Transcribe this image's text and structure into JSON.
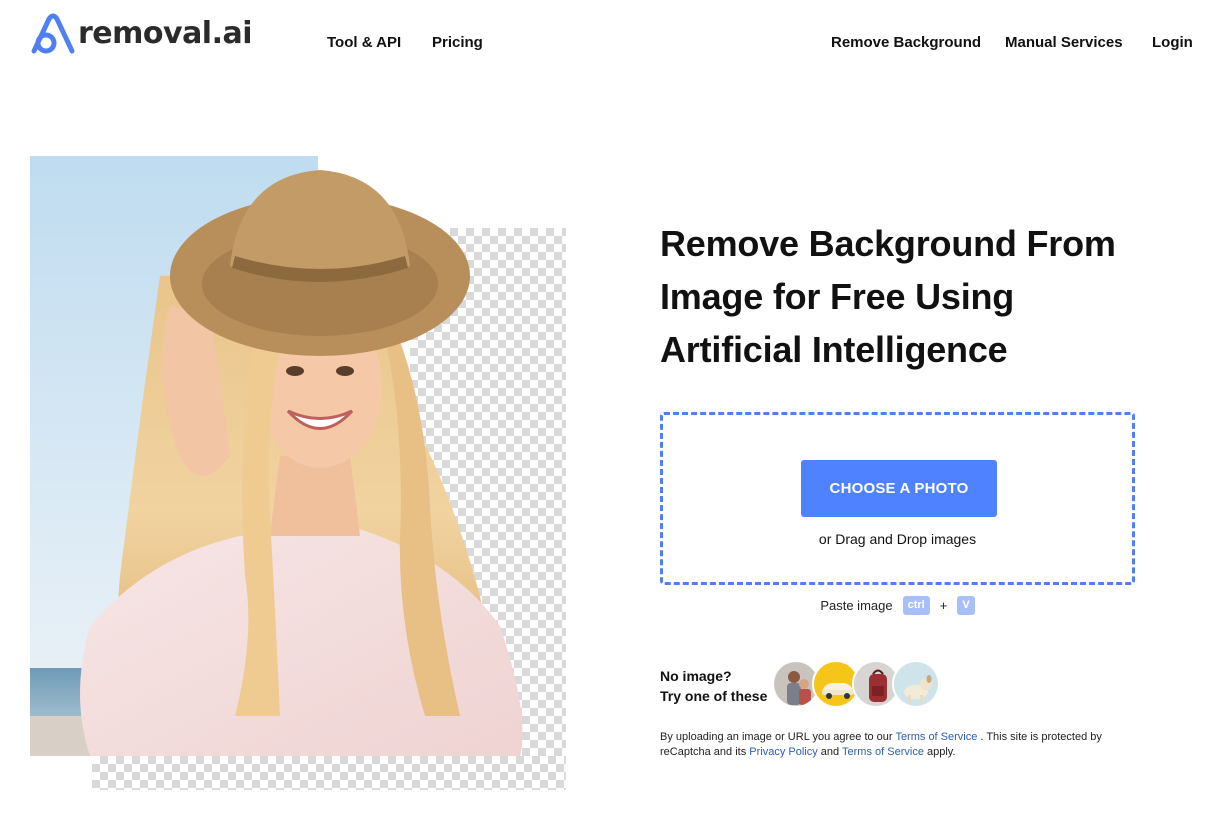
{
  "brand": {
    "name": "removal",
    "tld": ".ai",
    "accent": "#4f7ff2"
  },
  "nav": {
    "left": [
      {
        "label": "Tool & API"
      },
      {
        "label": "Pricing"
      }
    ],
    "right": [
      {
        "label": "Remove Background"
      },
      {
        "label": "Manual Services"
      },
      {
        "label": "Login"
      }
    ]
  },
  "hero": {
    "headline_line1": "Remove Background From",
    "headline_line2": "Image for Free Using",
    "headline_line3": "Artificial Intelligence",
    "image_subject": "smiling woman in straw hat on beach, background partially removed"
  },
  "upload": {
    "button_label": "CHOOSE A PHOTO",
    "drag_text": "or Drag and Drop images",
    "button_color": "#4f82ff"
  },
  "paste": {
    "label": "Paste image",
    "key1": "ctrl",
    "plus": "+",
    "key2": "V"
  },
  "samples": {
    "line1": "No image?",
    "line2": "Try one of these",
    "items": [
      {
        "icon": "family-photo"
      },
      {
        "icon": "yellow-car"
      },
      {
        "icon": "red-backpack"
      },
      {
        "icon": "white-dog"
      }
    ]
  },
  "terms": {
    "part1": "By uploading an image or URL you agree to our ",
    "tos_link": "Terms of Service",
    "part2": " . This site is protected by reCaptcha and its ",
    "privacy_link": "Privacy Policy",
    "part3": " and ",
    "tos_link2": "Terms of Service",
    "part4": " apply."
  }
}
